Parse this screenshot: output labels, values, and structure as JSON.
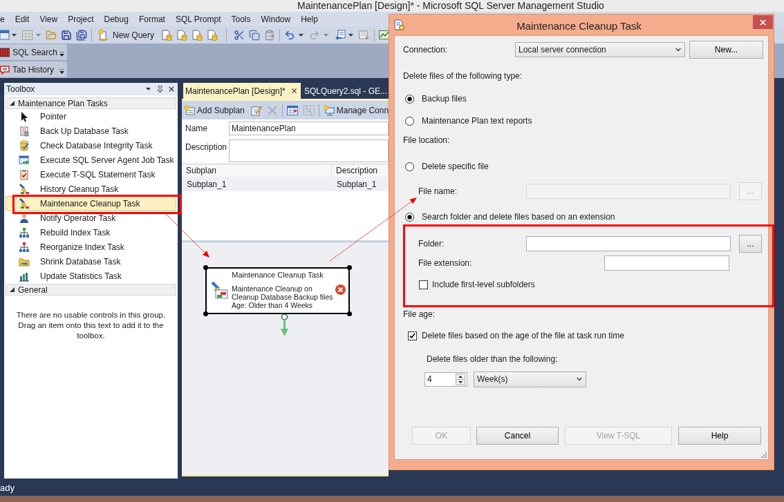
{
  "window": {
    "title": "MaintenancePlan [Design]* - Microsoft SQL Server Management Studio"
  },
  "menu": [
    {
      "label": "e"
    },
    {
      "label": "Edit"
    },
    {
      "label": "View"
    },
    {
      "label": "Project"
    },
    {
      "label": "Debug"
    },
    {
      "label": "Format"
    },
    {
      "label": "SQL Prompt"
    },
    {
      "label": "Tools"
    },
    {
      "label": "Window"
    },
    {
      "label": "Help"
    }
  ],
  "toolbar": {
    "new_query": "New Query"
  },
  "toolstrips": [
    {
      "label": "SQL Search"
    },
    {
      "label": "Tab History"
    }
  ],
  "toolbox": {
    "title": "Toolbox",
    "groups": [
      {
        "label": "Maintenance Plan Tasks",
        "expanded": true,
        "items": [
          {
            "label": "Pointer",
            "selected": false
          },
          {
            "label": "Back Up Database Task",
            "selected": false
          },
          {
            "label": "Check Database Integrity Task",
            "selected": false
          },
          {
            "label": "Execute SQL Server Agent Job Task",
            "selected": false
          },
          {
            "label": "Execute T-SQL Statement Task",
            "selected": false
          },
          {
            "label": "History Cleanup Task",
            "selected": false
          },
          {
            "label": "Maintenance Cleanup Task",
            "selected": true
          },
          {
            "label": "Notify Operator Task",
            "selected": false
          },
          {
            "label": "Rebuild Index Task",
            "selected": false
          },
          {
            "label": "Reorganize Index Task",
            "selected": false
          },
          {
            "label": "Shrink Database Task",
            "selected": false
          },
          {
            "label": "Update Statistics Task",
            "selected": false
          }
        ]
      },
      {
        "label": "General",
        "expanded": true,
        "message": "There are no usable controls in this group. Drag an item onto this text to add it to the toolbox."
      }
    ]
  },
  "document_tabs": [
    {
      "label": "MaintenancePlan [Design]*",
      "selected": true
    },
    {
      "label": "SQLQuery2.sql - GE...",
      "selected": false
    }
  ],
  "designer": {
    "toolbar": [
      {
        "label": "Add Subplan",
        "disabled": false
      },
      {
        "disabled": false
      },
      {
        "disabled": true
      },
      {
        "disabled": false
      },
      {
        "disabled": true
      },
      {
        "label": "Manage Conn",
        "disabled": false
      }
    ],
    "name": {
      "label": "Name",
      "value": "MaintenancePlan"
    },
    "description": {
      "label": "Description"
    },
    "subplans": {
      "columns": [
        "Subplan",
        "Description"
      ],
      "rows": [
        {
          "cells": [
            "Subplan_1",
            "Subplan_1"
          ],
          "selected": true
        }
      ]
    },
    "task": {
      "title": "Maintenance Cleanup Task",
      "lines": [
        "Maintenance Cleanup on",
        "Cleanup Database Backup files",
        "Age: Older than 4 Weeks"
      ],
      "error": true
    }
  },
  "dialog": {
    "title": "Maintenance Cleanup Task",
    "connection": {
      "label": "Connection:",
      "value": "Local server connection",
      "button": "New..."
    },
    "file_type": {
      "label": "Delete files of the following type:",
      "options": [
        {
          "label": "Backup files",
          "selected": true
        },
        {
          "label": "Maintenance Plan text reports",
          "selected": false
        }
      ]
    },
    "file_location": {
      "label": "File location:",
      "specific": {
        "label": "Delete specific file",
        "selected": false
      },
      "file_name": {
        "label": "File name:",
        "disabled": true,
        "browse": "..."
      },
      "search": {
        "label": "Search folder and delete files based on an extension",
        "selected": true
      },
      "folder": {
        "label": "Folder:",
        "browse": "..."
      },
      "extension": {
        "label": "File extension:"
      },
      "subfolders": {
        "label": "Include first-level subfolders",
        "checked": false
      }
    },
    "file_age": {
      "label": "File age:",
      "by_age": {
        "label": "Delete files based on the age of the file at task run time",
        "checked": true
      },
      "older_than": {
        "label": "Delete files older than the following:",
        "amount": "4",
        "unit": "Week(s)"
      }
    },
    "buttons": [
      {
        "label": "OK",
        "disabled": true
      },
      {
        "label": "Cancel",
        "disabled": false
      },
      {
        "label": "View T-SQL",
        "disabled": true
      },
      {
        "label": "Help",
        "disabled": false
      }
    ]
  },
  "status_bar": {
    "text": "ady"
  }
}
